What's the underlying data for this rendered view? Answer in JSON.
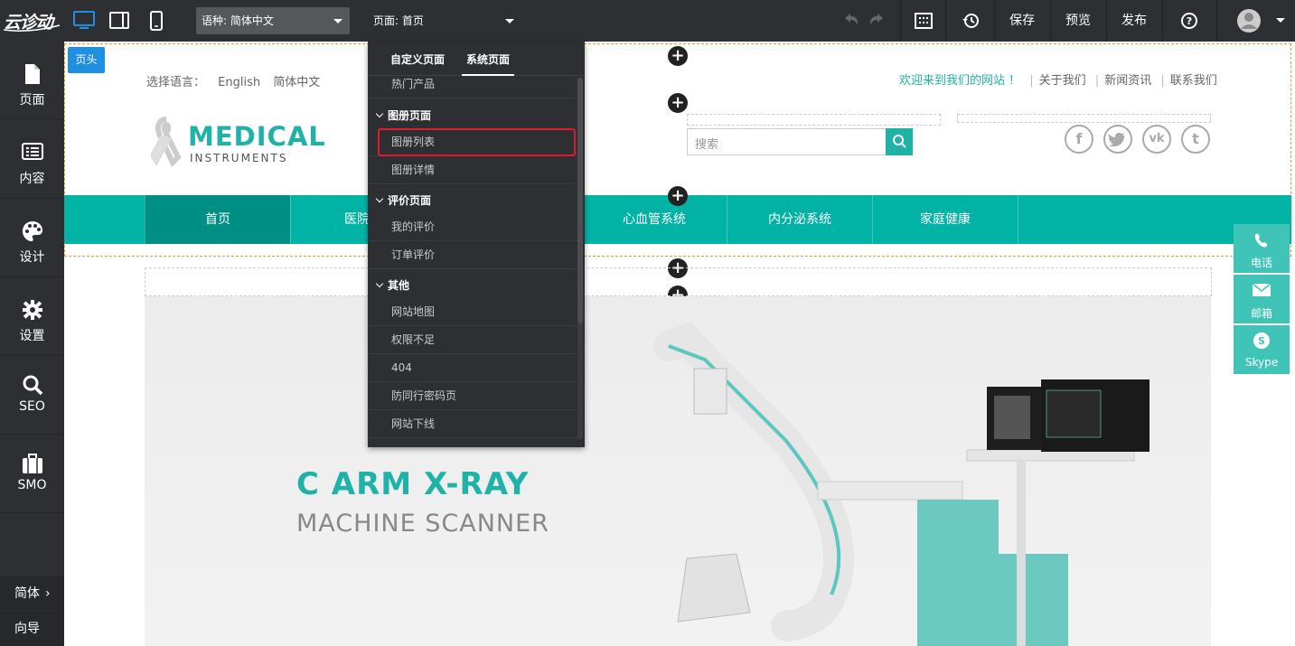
{
  "topbar": {
    "logo_text": "云诊动",
    "device_icons": [
      "desktop-icon",
      "tablet-icon",
      "mobile-icon"
    ],
    "language_select": "语种: 简体中文",
    "page_select": "页面: 首页",
    "save_label": "保存",
    "preview_label": "预览",
    "publish_label": "发布"
  },
  "sidebar": {
    "items": [
      {
        "label": "页面",
        "icon": "file-icon"
      },
      {
        "label": "内容",
        "icon": "content-icon"
      },
      {
        "label": "设计",
        "icon": "palette-icon"
      },
      {
        "label": "设置",
        "icon": "gear-icon"
      },
      {
        "label": "SEO",
        "icon": "search-icon"
      },
      {
        "label": "SMO",
        "icon": "briefcase-icon"
      }
    ],
    "bottom": [
      {
        "label": "简体"
      },
      {
        "label": "向导"
      }
    ]
  },
  "dropdown": {
    "tabs": [
      "自定义页面",
      "系统页面"
    ],
    "active_tab": "系统页面",
    "partial_top": "热门产品",
    "groups": [
      {
        "title": "图册页面",
        "items": [
          "图册列表",
          "图册详情"
        ]
      },
      {
        "title": "评价页面",
        "items": [
          "我的评价",
          "订单评价"
        ]
      },
      {
        "title": "其他",
        "items": [
          "网站地图",
          "权限不足",
          "404",
          "防同行密码页",
          "网站下线"
        ]
      }
    ],
    "highlighted": "图册列表"
  },
  "site": {
    "header_badge": "页头",
    "lang_label": "选择语言：",
    "langs": [
      "English",
      "简体中文"
    ],
    "welcome": "欢迎来到我们的网站 ！",
    "top_links": [
      "关于我们",
      "新闻资讯",
      "联系我们"
    ],
    "logo_main": "MEDICAL",
    "logo_sub": "INSTRUMENTS",
    "search_placeholder": "搜索",
    "social": [
      "f",
      "t",
      "vk",
      "t"
    ],
    "nav": [
      "首页",
      "医院设",
      "",
      "心血管系统",
      "内分泌系统",
      "家庭健康"
    ],
    "banner_title": "C ARM X-RAY",
    "banner_sub": "MACHINE SCANNER",
    "contact": [
      {
        "label": "电话",
        "icon": "phone-icon"
      },
      {
        "label": "邮箱",
        "icon": "mail-icon"
      },
      {
        "label": "Skype",
        "icon": "skype-icon"
      }
    ]
  },
  "colors": {
    "accent": "#00b3a5",
    "toolbar": "#2d2f33",
    "highlight": "#e0192d",
    "badge": "#1e8fe1"
  }
}
